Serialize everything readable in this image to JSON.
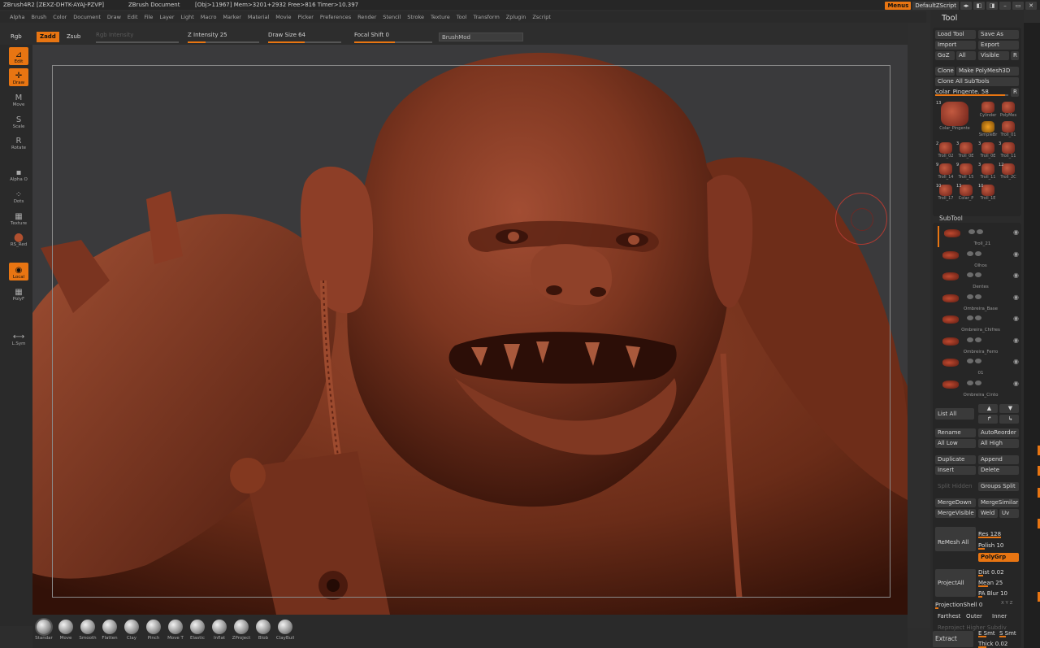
{
  "titlebar": {
    "app": "ZBrush4R2 [ZEXZ-DHTK-AYAJ-PZVP]",
    "document": "ZBrush Document",
    "stats": "[Obj>11967] Mem>3201+2932 Free>816 Timer>10.397",
    "menus_btn": "Menus",
    "script": "DefaultZScript"
  },
  "menubar": [
    "Alpha",
    "Brush",
    "Color",
    "Document",
    "Draw",
    "Edit",
    "File",
    "Layer",
    "Light",
    "Macro",
    "Marker",
    "Material",
    "Movie",
    "Picker",
    "Preferences",
    "Render",
    "Stencil",
    "Stroke",
    "Texture",
    "Tool",
    "Transform",
    "Zplugin",
    "Zscript"
  ],
  "top_controls": {
    "rgb": "Rgb",
    "zadd": "Zadd",
    "zsub": "Zsub",
    "rgb_intensity": "Rgb Intensity",
    "z_intensity": "Z Intensity 25",
    "z_intensity_value": 25,
    "draw_size": "Draw Size 64",
    "draw_size_value": 64,
    "focal_shift": "Focal Shift 0",
    "focal_shift_value": 0,
    "brushmod": "BrushMod"
  },
  "left_tools": [
    {
      "label": "Edit",
      "icon": "edit-icon",
      "active": true
    },
    {
      "label": "Draw",
      "icon": "draw-icon",
      "active": true
    },
    {
      "label": "Move",
      "icon": "move-icon",
      "active": false
    },
    {
      "label": "Scale",
      "icon": "scale-icon",
      "active": false
    },
    {
      "label": "Rotate",
      "icon": "rotate-icon",
      "active": false
    },
    {
      "label": "Alpha O",
      "icon": "alpha-icon",
      "active": false
    },
    {
      "label": "Dots",
      "icon": "dots-icon",
      "active": false
    },
    {
      "label": "Texture",
      "icon": "texture-icon",
      "active": false
    },
    {
      "label": "RS_Red",
      "icon": "material-icon",
      "active": false
    },
    {
      "label": "Local",
      "icon": "local-icon",
      "active": true
    },
    {
      "label": "PolyF",
      "icon": "polyframe-icon",
      "active": false
    },
    {
      "label": "L.Sym",
      "icon": "symmetry-icon",
      "active": false
    }
  ],
  "brushes": [
    "Standar",
    "Move",
    "Smooth",
    "Flatten",
    "Clay",
    "Pinch",
    "Move T",
    "Elastic",
    "Inflat",
    "ZProject",
    "Blob",
    "ClayBuil"
  ],
  "tool_panel": {
    "title": "Tool",
    "load_tool": "Load Tool",
    "save_as": "Save As",
    "import": "Import",
    "export": "Export",
    "goz": "GoZ",
    "all": "All",
    "visible": "Visible",
    "r": "R",
    "clone": "Clone",
    "make_polymesh": "Make PolyMesh3D",
    "clone_all": "Clone All SubTools",
    "current_tool": "Colar_Pingente. 58",
    "tiles": [
      {
        "n": "13",
        "label": "Colar_Pingente"
      },
      {
        "n": "",
        "label": "Cylinder"
      },
      {
        "n": "",
        "label": "PolyMes"
      },
      {
        "n": "",
        "label": "SimpleBr"
      },
      {
        "n": "",
        "label": "Troll_01"
      },
      {
        "n": "2",
        "label": "Troll_02"
      },
      {
        "n": "3",
        "label": "Troll_0E"
      },
      {
        "n": "3",
        "label": "Troll_0E"
      },
      {
        "n": "3",
        "label": "Troll_11"
      },
      {
        "n": "9",
        "label": "Troll_14"
      },
      {
        "n": "9",
        "label": "Troll_15"
      },
      {
        "n": "3",
        "label": "Troll_11"
      },
      {
        "n": "12",
        "label": "Troll_2C"
      },
      {
        "n": "10",
        "label": "Troll_17"
      },
      {
        "n": "13",
        "label": "Colar_P"
      },
      {
        "n": "10",
        "label": "Troll_1E"
      }
    ],
    "subtool_title": "SubTool",
    "subtools": [
      "Troll_21",
      "Olhos",
      "Dentes",
      "Ombreira_Base",
      "Ombreira_Chifres",
      "Ombreira_Ferro",
      "01",
      "Ombreira_Cinto"
    ],
    "list_all": "List All",
    "rename": "Rename",
    "autoreorder": "AutoReorder",
    "all_low": "All Low",
    "all_high": "All High",
    "duplicate": "Duplicate",
    "append": "Append",
    "insert": "Insert",
    "delete": "Delete",
    "split_hidden": "Split Hidden",
    "groups_split": "Groups Split",
    "mergedown": "MergeDown",
    "mergesimilar": "MergeSimilar",
    "mergevisible": "MergeVisible",
    "weld": "Weld",
    "uv": "Uv",
    "remesh_all": "ReMesh All",
    "res": "Res 128",
    "polish": "Polish 10",
    "polygrp": "PolyGrp",
    "projectall": "ProjectAll",
    "dist": "Dist 0.02",
    "mean": "Mean 25",
    "pa_blur": "PA Blur 10",
    "projectionshell": "ProjectionShell 0",
    "xyz": "X Y Z",
    "farthest": "Farthest",
    "outer": "Outer",
    "inner": "Inner",
    "reproject": "Reproject Higher Subdiv",
    "extract": "Extract",
    "e_smt": "E Smt",
    "s_smt": "S Smt",
    "thick": "Thick 0.02"
  },
  "colors": {
    "accent": "#e87512",
    "skin": "#8a3c26",
    "viewport_bg": "#3a3a3c"
  }
}
